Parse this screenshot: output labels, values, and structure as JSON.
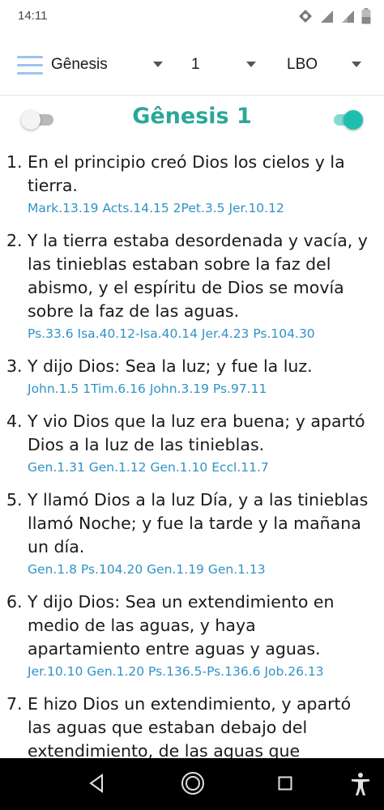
{
  "status_bar": {
    "time": "14:11",
    "icons": [
      "vpn-key-icon",
      "signal-icon",
      "signal-icon",
      "battery-icon"
    ]
  },
  "toolbar": {
    "menu_icon": "menu-icon",
    "book": "Gênesis",
    "chapter": "1",
    "version": "LBO"
  },
  "header": {
    "title": "Gênesis 1",
    "left_toggle": "off",
    "right_toggle": "on",
    "accent_color": "#2ba79a"
  },
  "verses": [
    {
      "num": "1.",
      "text": "En el principio creó Dios los cielos y la tierra.",
      "refs": "Mark.13.19 Acts.14.15 2Pet.3.5 Jer.10.12"
    },
    {
      "num": "2.",
      "text": "Y la tierra estaba desordenada y vacía, y las tinieblas estaban sobre la faz del abismo, y el espíritu de Dios se movía sobre la faz de las aguas.",
      "refs": "Ps.33.6 Isa.40.12-Isa.40.14 Jer.4.23 Ps.104.30"
    },
    {
      "num": "3.",
      "text": "Y dijo Dios: Sea la luz; y fue la luz.",
      "refs": "John.1.5 1Tim.6.16 John.3.19 Ps.97.11"
    },
    {
      "num": "4.",
      "text": "Y vio Dios que la luz era buena; y apartó Dios a la luz de las tinieblas.",
      "refs": "Gen.1.31 Gen.1.12 Gen.1.10 Eccl.11.7"
    },
    {
      "num": "5.",
      "text": "Y llamó Dios a la luz Día, y a las tinieblas llamó Noche; y fue la tarde y la mañana un día.",
      "refs": "Gen.1.8 Ps.104.20 Gen.1.19 Gen.1.13"
    },
    {
      "num": "6.",
      "text": "Y dijo Dios: Sea un extendimiento en medio de las aguas, y haya apartamiento entre aguas y aguas.",
      "refs": "Jer.10.10 Gen.1.20 Ps.136.5-Ps.136.6 Job.26.13"
    },
    {
      "num": "7.",
      "text": "E hizo Dios un extendimiento, y apartó las aguas que estaban debajo del extendimiento, de las aguas que estaban sobre el extendimiento: y fue así.",
      "refs": ""
    }
  ],
  "nav_bar": {
    "buttons": [
      "back-icon",
      "home-icon",
      "recents-icon",
      "accessibility-icon"
    ]
  }
}
